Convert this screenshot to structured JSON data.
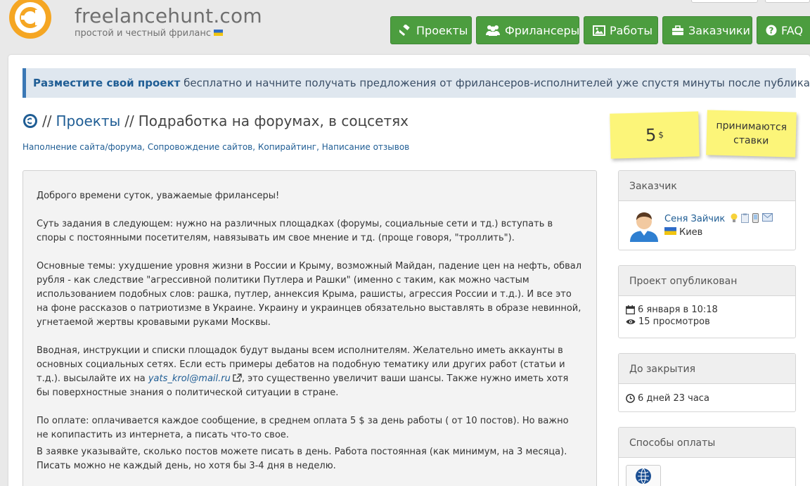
{
  "header": {
    "logo_text": "freelancehunt.com",
    "tagline": "простой и честный фриланс",
    "nav": [
      {
        "label": "Проекты",
        "icon": "gavel-icon"
      },
      {
        "label": "Фрилансеры",
        "icon": "users-icon"
      },
      {
        "label": "Работы",
        "icon": "picture-icon"
      },
      {
        "label": "Заказчики",
        "icon": "briefcase-icon"
      },
      {
        "label": "FAQ",
        "icon": "question-icon"
      }
    ]
  },
  "promo": {
    "link": "Разместите свой проект",
    "text": " бесплатно и начните получать предложения от фрилансеров-исполнителей уже спустя минуты после публикации!"
  },
  "title": {
    "sep1": "//",
    "projects_link": "Проекты",
    "sep2": "//",
    "name": "Подработка на форумах, в соцсетях"
  },
  "categories": [
    "Наполнение сайта/форума",
    "Сопровождение сайтов",
    "Копирайтинг",
    "Написание отзывов"
  ],
  "budget": {
    "value": "5",
    "currency": "$",
    "bids": "принимаются ставки"
  },
  "description": {
    "p1": "Доброго времени суток, уважаемые фрилансеры!",
    "p2": "Суть задания в следующем: нужно на различных площадках (форумы, социальные сети и тд.) вступать в споры с постоянными посетителям, навязывать им свое мнение и тд. (проще говоря, \"троллить\").",
    "p3": "Основные темы: ухудшение уровня жизни в России и Крыму, возможный Майдан, падение цен на нефть, обвал рубля - как следствие \"агрессивной политики Путлера и Рашки\" (именно с таким, как можно частым использованием подобных слов: рашка, путлер, аннексия Крыма, рашисты, агрессия России и т.д.). И все это на фоне рассказов о патриотизме в Украине. Украину и украинцев обязательно выставлять в образе невинной, угнетаемой жертвы кровавыми руками Москвы.",
    "p4a": "Вводная, инструкции и списки площадок будут выданы всем исполнителям. Желательно иметь аккаунты в основных социальных сетях. Если есть примеры дебатов на подобную тематику или других работ (статьи и т.д.). высылайте их на ",
    "email": "yats_krol@mail.ru",
    "p4b": ", это существенно увеличит ваши шансы. Также нужно иметь хотя бы поверхностные знания о политической ситуации в стране.",
    "p5": "По оплате: оплачивается каждое сообщение, в среднем оплата 5 $ за день работы ( от 10 постов). Но важно не копипастить из интернета, а писать что-то свое.",
    "p6": "В заявке указывайте, сколько постов можете писать в день. Работа постоянная (как минимум, на 3 месяца). Писать можно не каждый день, но хотя бы 3-4 дня в неделю."
  },
  "sidebar": {
    "client": {
      "heading": "Заказчик",
      "name": "Сеня Зайчик",
      "city": "Киев"
    },
    "published": {
      "heading": "Проект опубликован",
      "date": "6 января в 10:18",
      "views": "15 просмотров"
    },
    "closing": {
      "heading": "До закрытия",
      "remaining": "6 дней 23 часа"
    },
    "payment": {
      "heading": "Способы оплаты",
      "method_icon": "webmoney-icon"
    }
  },
  "colors": {
    "nav_green": "#4c9d3f",
    "link_blue": "#1f5d94",
    "sticky_yellow": "#fcf579",
    "logo_orange": "#f5a623"
  }
}
